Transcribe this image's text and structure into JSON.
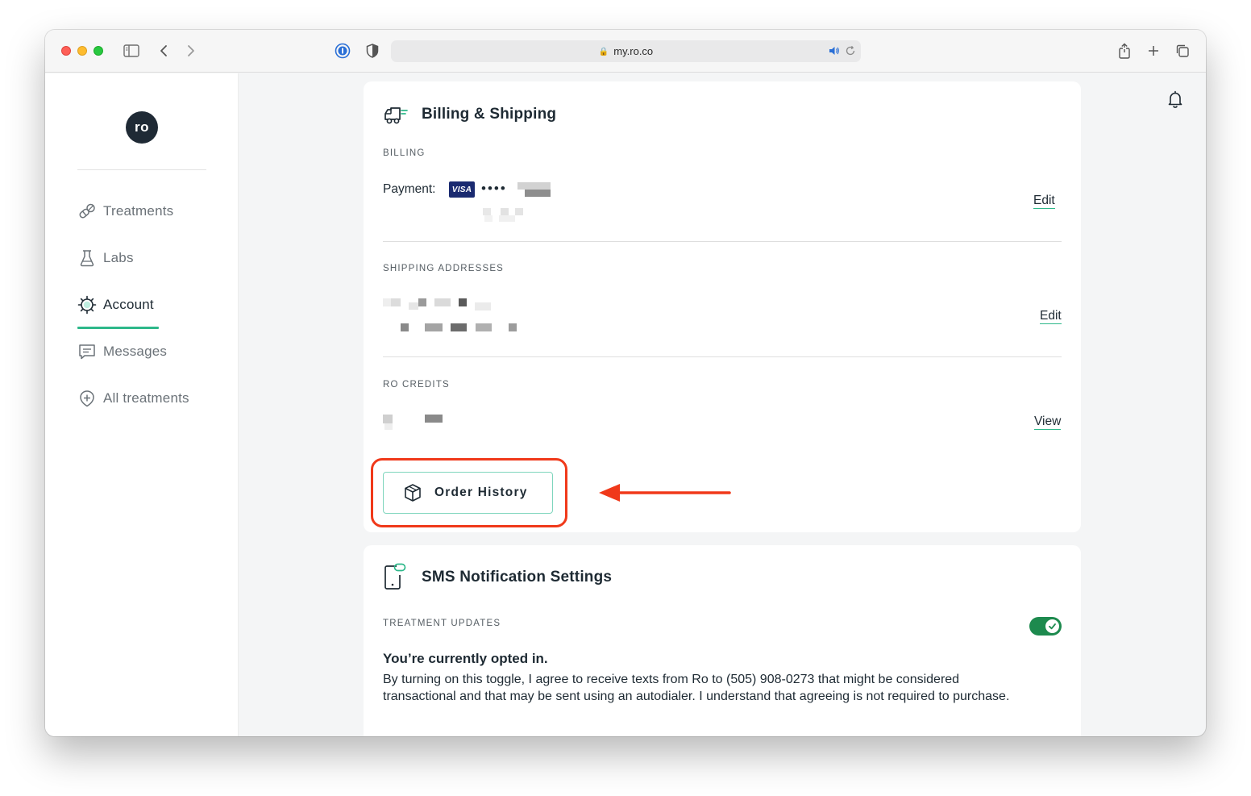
{
  "browser": {
    "url": "my.ro.co"
  },
  "brand": {
    "logo_text": "ro",
    "accent_color": "#2eb88a",
    "toggle_color": "#1d8a4e",
    "highlight_color": "#f0391a"
  },
  "sidebar": {
    "items": [
      {
        "label": "Treatments",
        "icon": "pill-icon",
        "active": false
      },
      {
        "label": "Labs",
        "icon": "flask-icon",
        "active": false
      },
      {
        "label": "Account",
        "icon": "gear-icon",
        "active": true
      },
      {
        "label": "Messages",
        "icon": "message-icon",
        "active": false
      },
      {
        "label": "All treatments",
        "icon": "shield-plus-icon",
        "active": false
      }
    ]
  },
  "billing_card": {
    "title": "Billing & Shipping",
    "billing": {
      "section_label": "BILLING",
      "payment_label": "Payment:",
      "card_brand": "VISA",
      "masked_dots": "••••",
      "edit_label": "Edit"
    },
    "shipping": {
      "section_label": "SHIPPING ADDRESSES",
      "edit_label": "Edit"
    },
    "credits": {
      "section_label": "RO CREDITS",
      "view_label": "View"
    },
    "order_history_label": "Order History"
  },
  "sms_card": {
    "title": "SMS Notification Settings",
    "section_label": "TREATMENT UPDATES",
    "toggle_on": true,
    "opted_in_heading": "You’re currently opted in.",
    "opted_in_body": "By turning on this toggle, I agree to receive texts from Ro to (505) 908-0273 that might be considered transactional and that may be sent using an autodialer. I understand that agreeing is not required to purchase."
  }
}
